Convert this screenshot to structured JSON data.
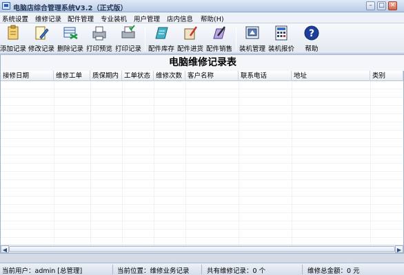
{
  "window": {
    "title": "电脑店综合管理系统V3.2（正式版）",
    "min_label": "–",
    "max_label": "□",
    "close_label": "✕"
  },
  "menu": [
    {
      "label": "系统设置"
    },
    {
      "label": "维修记录"
    },
    {
      "label": "配件管理"
    },
    {
      "label": "专业装机"
    },
    {
      "label": "用户管理"
    },
    {
      "label": "店内信息"
    },
    {
      "label": "帮助(H)"
    }
  ],
  "toolbar": [
    {
      "label": "添加记录",
      "icon": "add-record-icon"
    },
    {
      "label": "修改记录",
      "icon": "edit-record-icon"
    },
    {
      "label": "删除记录",
      "icon": "delete-record-icon"
    },
    {
      "label": "打印预览",
      "icon": "print-preview-icon"
    },
    {
      "label": "打印记录",
      "icon": "print-record-icon"
    },
    {
      "label": "配件库存",
      "icon": "parts-stock-icon"
    },
    {
      "label": "配件进货",
      "icon": "parts-purchase-icon"
    },
    {
      "label": "配件销售",
      "icon": "parts-sales-icon"
    },
    {
      "label": "装机管理",
      "icon": "build-manage-icon"
    },
    {
      "label": "装机报价",
      "icon": "build-quote-icon"
    },
    {
      "label": "帮助",
      "icon": "help-icon"
    }
  ],
  "report": {
    "title": "电脑维修记录表",
    "columns": [
      "接修日期",
      "维修工单",
      "质保期内",
      "工单状态",
      "维修次数",
      "客户名称",
      "联系电话",
      "地址",
      "类别"
    ],
    "rows": []
  },
  "status": {
    "user": "当前用户：admin [总管理]",
    "location": "当前位置：维修业务记录",
    "record_count": "共有维修记录：0 个",
    "total_amount": "维修总金额：0 元"
  },
  "colors": {
    "accent": "#2a5fa8",
    "help": "#1d3f9c"
  }
}
